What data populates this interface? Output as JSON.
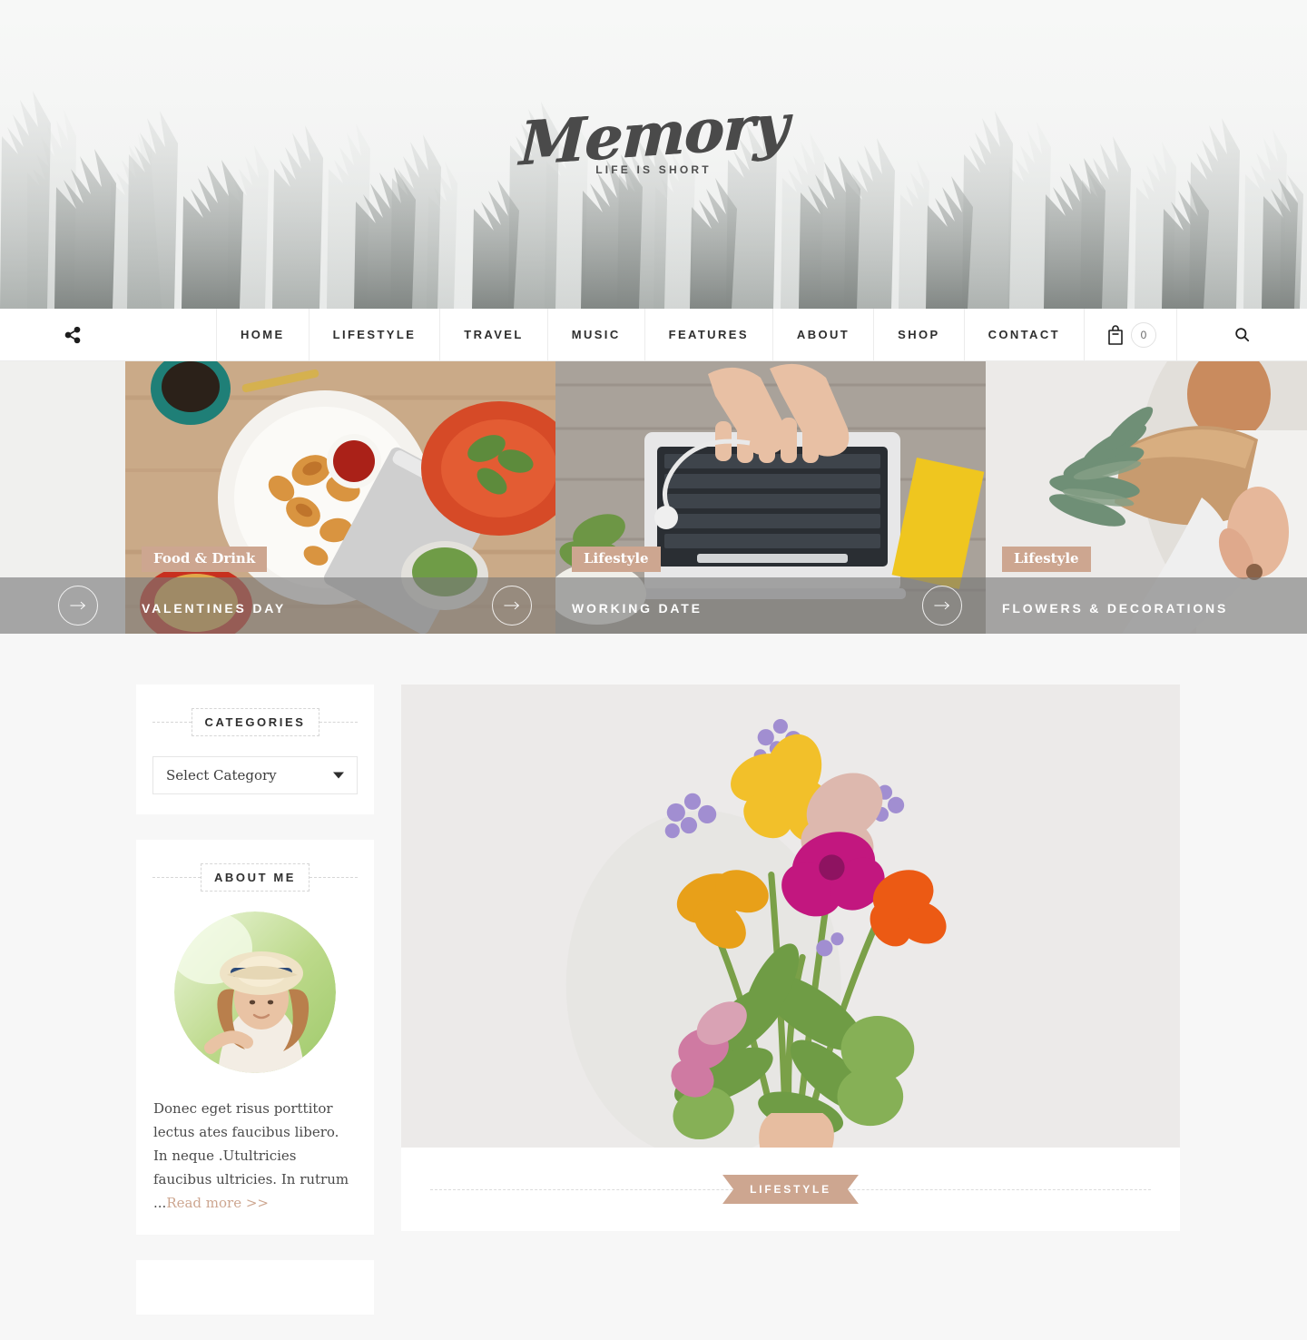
{
  "header": {
    "logo_word": "Memory",
    "tagline": "LIFE IS SHORT"
  },
  "nav": {
    "share_icon": "share-icon",
    "items": [
      {
        "label": "HOME"
      },
      {
        "label": "LIFESTYLE"
      },
      {
        "label": "TRAVEL"
      },
      {
        "label": "MUSIC"
      },
      {
        "label": "FEATURES"
      },
      {
        "label": "ABOUT"
      },
      {
        "label": "SHOP"
      },
      {
        "label": "CONTACT"
      }
    ],
    "cart": {
      "icon": "shopping-bag-icon",
      "count": "0"
    },
    "search_icon": "search-icon"
  },
  "slider": {
    "next_arrow_icon": "arrow-right-icon",
    "slides": [
      {
        "category": "",
        "title": "",
        "arrow": "→"
      },
      {
        "category": "Food & Drink",
        "title": "VALENTINES DAY",
        "arrow": "→"
      },
      {
        "category": "Lifestyle",
        "title": "WORKING DATE",
        "arrow": "→"
      },
      {
        "category": "Lifestyle",
        "title": "FLOWERS & DECORATIONS",
        "arrow": "→"
      }
    ]
  },
  "sidebar": {
    "categories_widget": {
      "title": "CATEGORIES",
      "select_value": "Select Category"
    },
    "about_widget": {
      "title": "ABOUT ME",
      "avatar_icon": "author-avatar",
      "text": "Donec eget risus porttitor lectus ates faucibus libero. In neque .Utultricies faucibus ultricies. In rutrum ...",
      "read_more": "Read more >>"
    }
  },
  "main": {
    "post": {
      "image_alt": "bouquet-of-flowers-held-in-hand",
      "category_ribbon": "LIFESTYLE"
    }
  },
  "colors": {
    "accent": "#cda690",
    "nav_text": "#2e2e2e",
    "page_bg": "#f7f7f7",
    "card_bg": "#ffffff",
    "overlay": "rgba(120,120,120,0.62)"
  }
}
